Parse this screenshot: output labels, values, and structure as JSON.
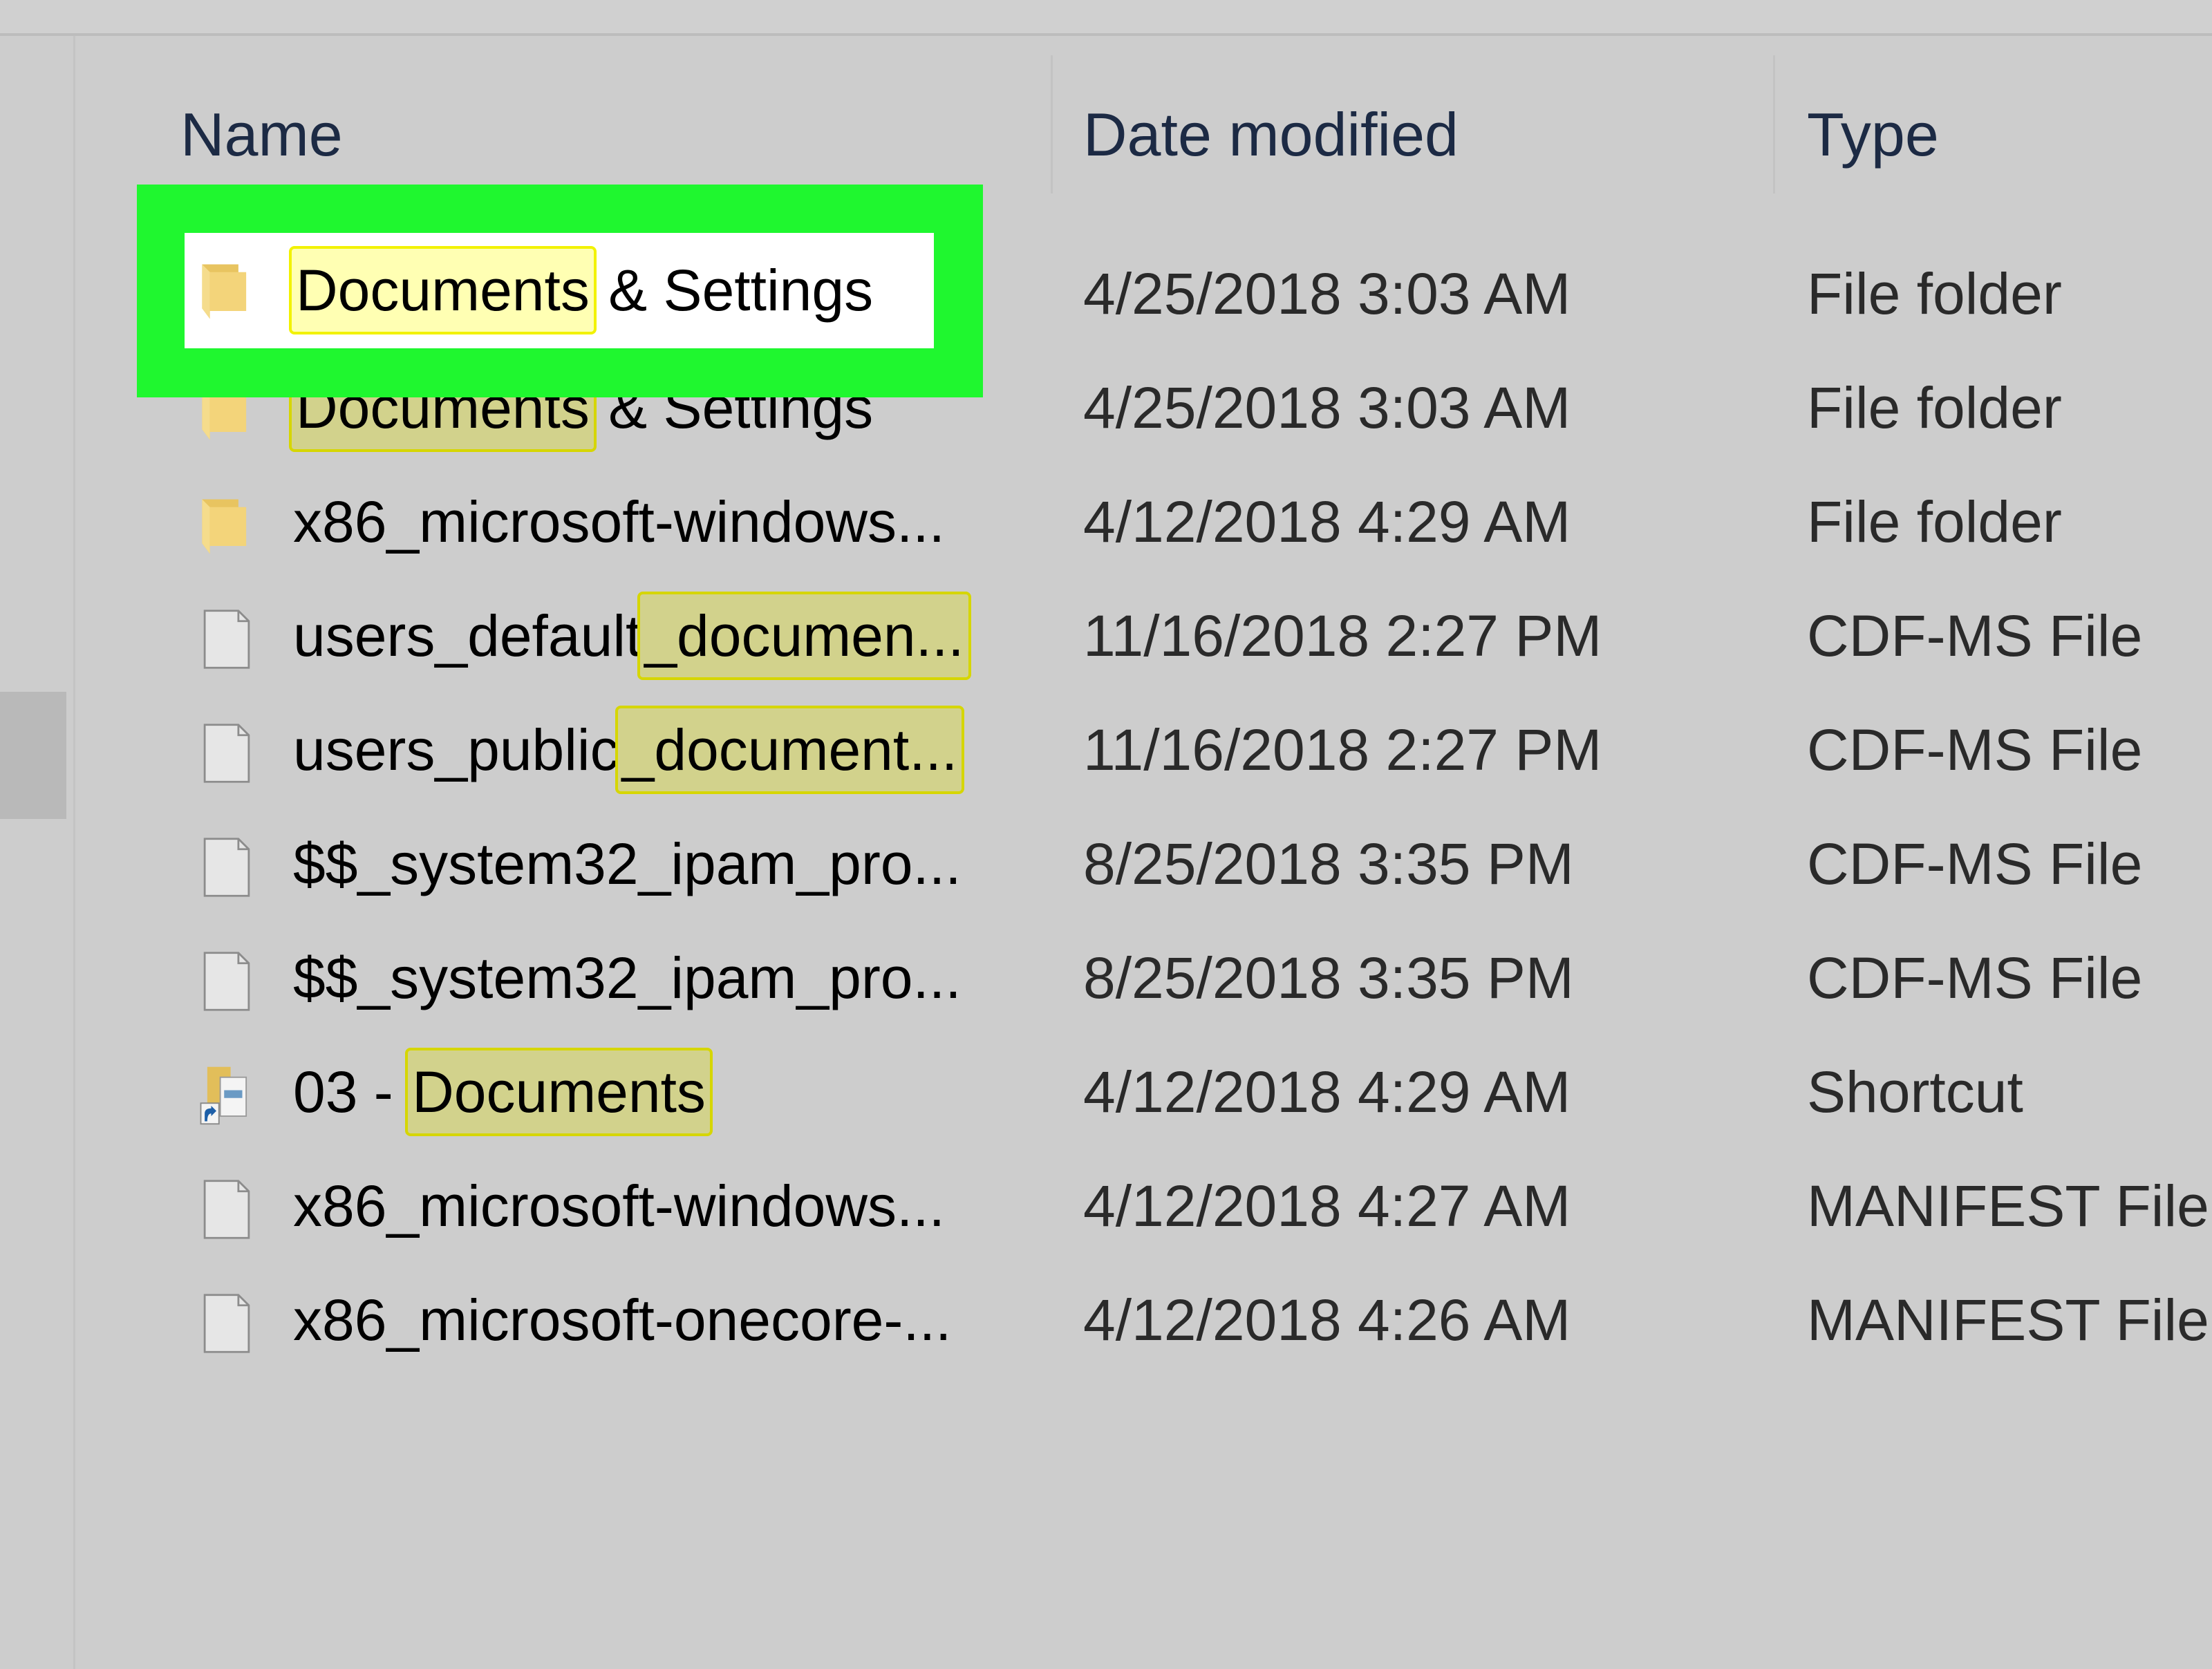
{
  "columns": {
    "name": "Name",
    "date": "Date modified",
    "type": "Type"
  },
  "colors": {
    "callout": "#1ff72f",
    "highlight": "#ffffb3"
  },
  "callout": {
    "icon": "folder-icon",
    "name_parts": [
      {
        "text": "Documents",
        "hl": true
      },
      {
        "text": " & Settings",
        "hl": false
      }
    ]
  },
  "rows": [
    {
      "icon": "folder-icon",
      "name_parts": [
        {
          "text": "Documents",
          "hl": true
        },
        {
          "text": " & Settings",
          "hl": false
        }
      ],
      "date": "4/25/2018 3:03 AM",
      "type": "File folder"
    },
    {
      "icon": "folder-icon",
      "name_parts": [
        {
          "text": "Documents",
          "hl": true
        },
        {
          "text": " & Settings",
          "hl": false
        }
      ],
      "date": "4/25/2018 3:03 AM",
      "type": "File folder"
    },
    {
      "icon": "folder-icon",
      "name_parts": [
        {
          "text": "x86_microsoft-windows...",
          "hl": false
        }
      ],
      "date": "4/12/2018 4:29 AM",
      "type": "File folder"
    },
    {
      "icon": "file-icon",
      "name_parts": [
        {
          "text": "users_default",
          "hl": false
        },
        {
          "text": "_documen...",
          "hl": true
        }
      ],
      "date": "11/16/2018 2:27 PM",
      "type": "CDF-MS File"
    },
    {
      "icon": "file-icon",
      "name_parts": [
        {
          "text": "users_public",
          "hl": false
        },
        {
          "text": "_document...",
          "hl": true
        }
      ],
      "date": "11/16/2018 2:27 PM",
      "type": "CDF-MS File"
    },
    {
      "icon": "file-icon",
      "name_parts": [
        {
          "text": "$$_system32_ipam_pro...",
          "hl": false
        }
      ],
      "date": "8/25/2018 3:35 PM",
      "type": "CDF-MS File"
    },
    {
      "icon": "file-icon",
      "name_parts": [
        {
          "text": "$$_system32_ipam_pro...",
          "hl": false
        }
      ],
      "date": "8/25/2018 3:35 PM",
      "type": "CDF-MS File"
    },
    {
      "icon": "shortcut-icon",
      "name_parts": [
        {
          "text": "03 - ",
          "hl": false
        },
        {
          "text": "Documents",
          "hl": true
        }
      ],
      "date": "4/12/2018 4:29 AM",
      "type": "Shortcut"
    },
    {
      "icon": "file-icon",
      "name_parts": [
        {
          "text": "x86_microsoft-windows...",
          "hl": false
        }
      ],
      "date": "4/12/2018 4:27 AM",
      "type": "MANIFEST File"
    },
    {
      "icon": "file-icon",
      "name_parts": [
        {
          "text": "x86_microsoft-onecore-...",
          "hl": false
        }
      ],
      "date": "4/12/2018 4:26 AM",
      "type": "MANIFEST File"
    }
  ]
}
